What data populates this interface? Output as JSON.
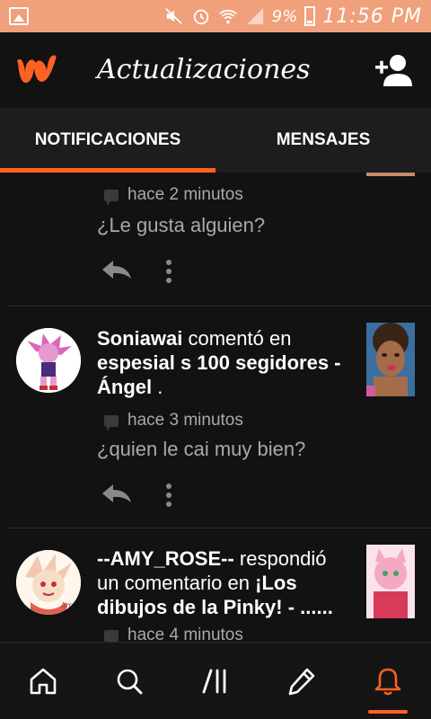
{
  "status_bar": {
    "battery": "9%",
    "time": "11:56 PM"
  },
  "header": {
    "title": "Actualizaciones"
  },
  "tabs": [
    {
      "label": "NOTIFICACIONES",
      "active": true
    },
    {
      "label": "MENSAJES",
      "active": false
    }
  ],
  "feed": [
    {
      "time": "hace 2 minutos",
      "comment": "¿Le gusta alguien?"
    },
    {
      "user": "Soniawai",
      "action": "comentó en",
      "story": "espesial s 100 segidores - Ángel",
      "end": ".",
      "time": "hace 3 minutos",
      "comment": "¿quien le cai muy bien?"
    },
    {
      "user": "--AMY_ROSE--",
      "action": "respondió un comentario en",
      "story": "¡Los dibujos de la Pinky! - ......",
      "time": "hace 4 minutos"
    }
  ],
  "colors": {
    "accent": "#ff6122",
    "status_bar": "#f0a07a",
    "background": "#121212"
  },
  "icons": {
    "logo": "wattpad-logo",
    "add_user": "add-user-icon",
    "nav": [
      "home-icon",
      "search-icon",
      "library-icon",
      "write-icon",
      "bell-icon"
    ]
  }
}
